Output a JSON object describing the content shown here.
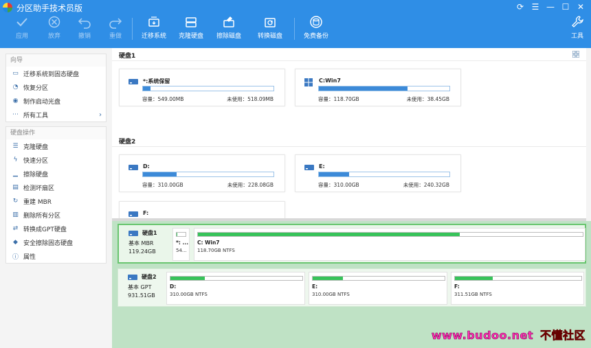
{
  "app": {
    "title": "分区助手技术员版"
  },
  "window_controls": [
    {
      "name": "refresh-icon",
      "glyph": "⟳"
    },
    {
      "name": "menu-icon",
      "glyph": "☰"
    },
    {
      "name": "minimize-icon",
      "glyph": "—"
    },
    {
      "name": "maximize-icon",
      "glyph": "☐"
    },
    {
      "name": "close-icon",
      "glyph": "✕"
    }
  ],
  "toolbar": {
    "apply": "应用",
    "discard": "放弃",
    "undo": "撤销",
    "redo": "重做",
    "migrate": "迁移系统",
    "clone": "克隆硬盘",
    "wipe": "擦除磁盘",
    "convert": "转换磁盘",
    "backup": "免费备份",
    "tools": "工具"
  },
  "sidebar": {
    "wizard_title": "向导",
    "wizard_items": [
      {
        "label": "迁移系统到固态硬盘",
        "icon": "migrate-ssd-icon"
      },
      {
        "label": "恢复分区",
        "icon": "restore-partition-icon"
      },
      {
        "label": "制作启动光盘",
        "icon": "boot-disc-icon"
      },
      {
        "label": "所有工具",
        "icon": "more-icon"
      }
    ],
    "ops_title": "硬盘操作",
    "ops_items": [
      {
        "label": "克隆硬盘",
        "icon": "clone-disk-icon"
      },
      {
        "label": "快速分区",
        "icon": "quick-partition-icon"
      },
      {
        "label": "擦除硬盘",
        "icon": "wipe-disk-icon"
      },
      {
        "label": "检测坏扇区",
        "icon": "bad-sector-icon"
      },
      {
        "label": "重建 MBR",
        "icon": "rebuild-mbr-icon"
      },
      {
        "label": "删除所有分区",
        "icon": "delete-partitions-icon"
      },
      {
        "label": "转换成GPT硬盘",
        "icon": "convert-gpt-icon"
      },
      {
        "label": "安全擦除固态硬盘",
        "icon": "secure-erase-icon"
      },
      {
        "label": "属性",
        "icon": "info-icon"
      }
    ]
  },
  "main": {
    "disk1_header": "硬盘1",
    "disk2_header": "硬盘2",
    "cap_label": "容量：",
    "free_label": "未使用：",
    "partitions": [
      {
        "name": "*:系统保留",
        "capacity": "549.00MB",
        "free": "518.09MB",
        "used": 0.06,
        "os": "drive"
      },
      {
        "name": "C:Win7",
        "capacity": "118.70GB",
        "free": "38.45GB",
        "used": 0.68,
        "os": "windows"
      },
      {
        "name": "D:",
        "capacity": "310.00GB",
        "free": "228.08GB",
        "used": 0.26,
        "os": "drive"
      },
      {
        "name": "E:",
        "capacity": "310.00GB",
        "free": "240.32GB",
        "used": 0.23,
        "os": "drive"
      },
      {
        "name": "F:",
        "capacity": "",
        "free": "",
        "used": 0,
        "os": "drive"
      }
    ]
  },
  "map": {
    "disk1": {
      "name": "硬盘1",
      "type": "基本 MBR",
      "size": "119.24GB",
      "parts": [
        {
          "name": "*: ...",
          "info": "54...",
          "used": 0.06
        },
        {
          "name": "C: Win7",
          "info": "118.70GB NTFS",
          "used": 0.68
        }
      ]
    },
    "disk2": {
      "name": "硬盘2",
      "type": "基本 GPT",
      "size": "931.51GB",
      "parts": [
        {
          "name": "D:",
          "info": "310.00GB NTFS",
          "used": 0.26
        },
        {
          "name": "E:",
          "info": "310.00GB NTFS",
          "used": 0.23
        },
        {
          "name": "F:",
          "info": "311.51GB NTFS",
          "used": 0.3
        }
      ]
    }
  },
  "watermark": {
    "url": "www.budoo.net",
    "cn": "不懂社区"
  }
}
